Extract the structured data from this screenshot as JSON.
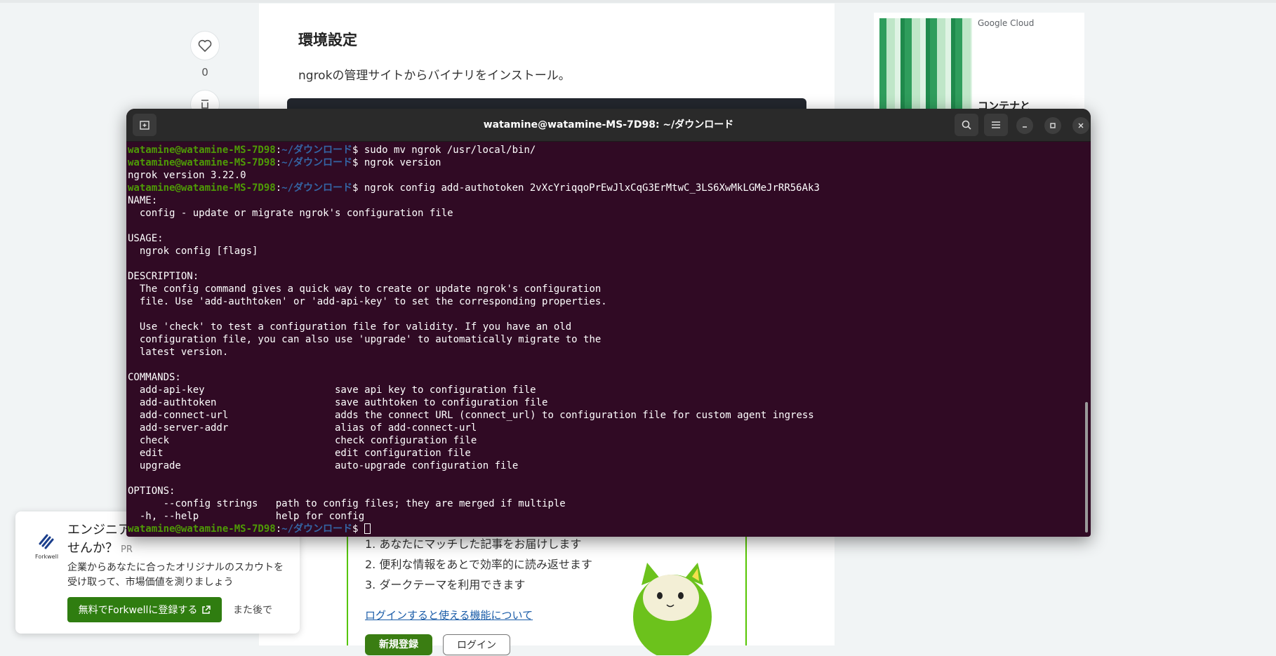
{
  "page": {
    "heading": "環境設定",
    "intro": "ngrokの管理サイトからバイナリをインストール。",
    "like_count": "0"
  },
  "ad": {
    "brand": "Google Cloud",
    "headline": "コンテナと"
  },
  "login_card": {
    "benefits": [
      "1. あなたにマッチした記事をお届けします",
      "2. 便利な情報をあとで効率的に読み返せます",
      "3. ダークテーマを利用できます"
    ],
    "link": "ログインすると使える機能について",
    "signup": "新規登録",
    "login": "ログイン"
  },
  "promo": {
    "logo_text": "Forkwell",
    "title": "エンジニアとしての市場価値を測りませんか？",
    "pr": "PR",
    "body": "企業からあなたに合ったオリジナルのスカウトを受け取って、市場価値を測りましょう",
    "cta": "無料でForkwellに登録する",
    "later": "また後で"
  },
  "terminal": {
    "title": "watamine@watamine-MS-7D98: ~/ダウンロード",
    "prompt_user": "watamine@watamine-MS-7D98",
    "prompt_path": "~/ダウンロード",
    "lines": [
      {
        "kind": "cmd",
        "text": "sudo mv ngrok /usr/local/bin/"
      },
      {
        "kind": "cmd",
        "text": "ngrok version"
      },
      {
        "kind": "out",
        "text": "ngrok version 3.22.0"
      },
      {
        "kind": "cmd",
        "text": "ngrok config add-authotoken 2vXcYriqqoPrEwJlxCqG3ErMtwC_3LS6XwMkLGMeJrRR56Ak3"
      },
      {
        "kind": "out",
        "text": "NAME:"
      },
      {
        "kind": "out",
        "text": "  config - update or migrate ngrok's configuration file"
      },
      {
        "kind": "out",
        "text": ""
      },
      {
        "kind": "out",
        "text": "USAGE:"
      },
      {
        "kind": "out",
        "text": "  ngrok config [flags]"
      },
      {
        "kind": "out",
        "text": ""
      },
      {
        "kind": "out",
        "text": "DESCRIPTION:"
      },
      {
        "kind": "out",
        "text": "  The config command gives a quick way to create or update ngrok's configuration"
      },
      {
        "kind": "out",
        "text": "  file. Use 'add-authtoken' or 'add-api-key' to set the corresponding properties."
      },
      {
        "kind": "out",
        "text": ""
      },
      {
        "kind": "out",
        "text": "  Use 'check' to test a configuration file for validity. If you have an old"
      },
      {
        "kind": "out",
        "text": "  configuration file, you can also use 'upgrade' to automatically migrate to the"
      },
      {
        "kind": "out",
        "text": "  latest version."
      },
      {
        "kind": "out",
        "text": ""
      },
      {
        "kind": "out",
        "text": "COMMANDS:"
      },
      {
        "kind": "out",
        "text": "  add-api-key                      save api key to configuration file"
      },
      {
        "kind": "out",
        "text": "  add-authtoken                    save authtoken to configuration file"
      },
      {
        "kind": "out",
        "text": "  add-connect-url                  adds the connect URL (connect_url) to configuration file for custom agent ingress"
      },
      {
        "kind": "out",
        "text": "  add-server-addr                  alias of add-connect-url"
      },
      {
        "kind": "out",
        "text": "  check                            check configuration file"
      },
      {
        "kind": "out",
        "text": "  edit                             edit configuration file"
      },
      {
        "kind": "out",
        "text": "  upgrade                          auto-upgrade configuration file"
      },
      {
        "kind": "out",
        "text": ""
      },
      {
        "kind": "out",
        "text": "OPTIONS:"
      },
      {
        "kind": "out",
        "text": "      --config strings   path to config files; they are merged if multiple"
      },
      {
        "kind": "out",
        "text": "  -h, --help             help for config"
      },
      {
        "kind": "cursor",
        "text": ""
      }
    ]
  }
}
